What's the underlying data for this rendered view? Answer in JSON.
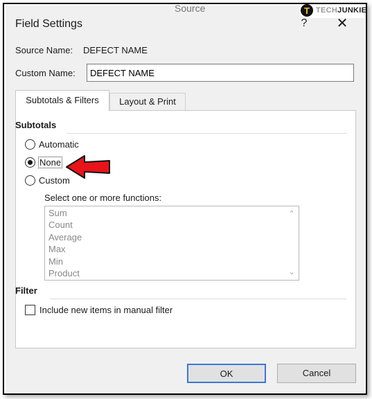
{
  "window": {
    "title": "Field Settings",
    "peek_title": "Source",
    "help_glyph": "?",
    "close_glyph": "✕"
  },
  "logo": {
    "mark": "T",
    "text_a": "TECH",
    "text_b": "JUNKIE"
  },
  "source": {
    "label": "Source Name:",
    "value": "DEFECT NAME"
  },
  "custom_name": {
    "label": "Custom Name:",
    "value": "DEFECT NAME"
  },
  "tabs": [
    {
      "label": "Subtotals & Filters",
      "active": true
    },
    {
      "label": "Layout & Print",
      "active": false
    }
  ],
  "subtotals": {
    "title": "Subtotals",
    "options": [
      {
        "label": "Automatic",
        "checked": false
      },
      {
        "label": "None",
        "checked": true
      },
      {
        "label": "Custom",
        "checked": false
      }
    ],
    "functions_label": "Select one or more functions:",
    "functions": [
      "Sum",
      "Count",
      "Average",
      "Max",
      "Min",
      "Product"
    ]
  },
  "filter": {
    "title": "Filter",
    "checkbox_label": "Include new items in manual filter",
    "checked": false
  },
  "buttons": {
    "ok": "OK",
    "cancel": "Cancel"
  },
  "colors": {
    "annotation_arrow": "#e8141a",
    "default_button_border": "#3b78d8"
  },
  "annotation": {
    "icon": "red-arrow-icon",
    "points_to": "None"
  }
}
